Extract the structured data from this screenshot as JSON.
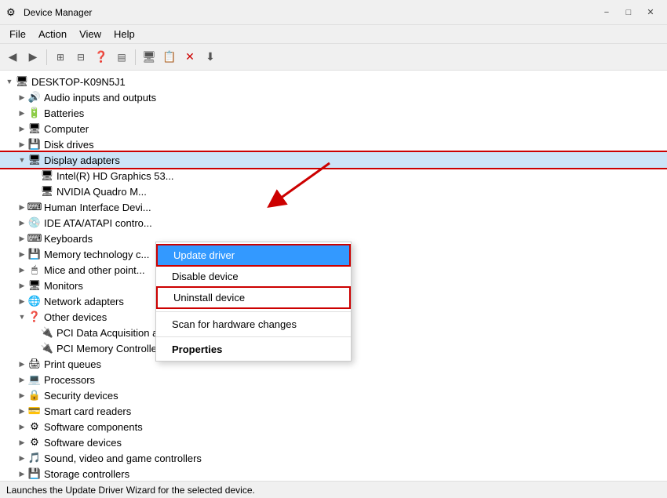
{
  "window": {
    "title": "Device Manager",
    "icon": "⚙"
  },
  "menubar": {
    "items": [
      "File",
      "Action",
      "View",
      "Help"
    ]
  },
  "toolbar": {
    "buttons": [
      "◀",
      "▶",
      "⊞",
      "⊟",
      "❓",
      "☰",
      "🖥",
      "📋",
      "✕",
      "⬇"
    ]
  },
  "tree": {
    "root": {
      "label": "DESKTOP-K09N5J1",
      "expanded": true
    },
    "items": [
      {
        "id": "audio",
        "label": "Audio inputs and outputs",
        "indent": 1,
        "expandable": true,
        "expanded": false,
        "icon": "🔊"
      },
      {
        "id": "batteries",
        "label": "Batteries",
        "indent": 1,
        "expandable": true,
        "expanded": false,
        "icon": "🔋"
      },
      {
        "id": "computer",
        "label": "Computer",
        "indent": 1,
        "expandable": true,
        "expanded": false,
        "icon": "🖥"
      },
      {
        "id": "disk",
        "label": "Disk drives",
        "indent": 1,
        "expandable": true,
        "expanded": false,
        "icon": "💾"
      },
      {
        "id": "display",
        "label": "Display adapters",
        "indent": 1,
        "expandable": true,
        "expanded": true,
        "icon": "🖥",
        "selected": true
      },
      {
        "id": "intel",
        "label": "Intel(R) HD Graphics 53...",
        "indent": 2,
        "expandable": false,
        "icon": "🖥"
      },
      {
        "id": "nvidia",
        "label": "NVIDIA Quadro M...",
        "indent": 2,
        "expandable": false,
        "icon": "🖥"
      },
      {
        "id": "hid",
        "label": "Human Interface Devi...",
        "indent": 1,
        "expandable": true,
        "expanded": false,
        "icon": "⌨"
      },
      {
        "id": "ide",
        "label": "IDE ATA/ATAPI contro...",
        "indent": 1,
        "expandable": true,
        "expanded": false,
        "icon": "💿"
      },
      {
        "id": "keyboards",
        "label": "Keyboards",
        "indent": 1,
        "expandable": true,
        "expanded": false,
        "icon": "⌨"
      },
      {
        "id": "memory",
        "label": "Memory technology c...",
        "indent": 1,
        "expandable": true,
        "expanded": false,
        "icon": "💾"
      },
      {
        "id": "mice",
        "label": "Mice and other point...",
        "indent": 1,
        "expandable": true,
        "expanded": false,
        "icon": "🖱"
      },
      {
        "id": "monitors",
        "label": "Monitors",
        "indent": 1,
        "expandable": true,
        "expanded": false,
        "icon": "🖥"
      },
      {
        "id": "network",
        "label": "Network adapters",
        "indent": 1,
        "expandable": true,
        "expanded": false,
        "icon": "🌐"
      },
      {
        "id": "other",
        "label": "Other devices",
        "indent": 1,
        "expandable": true,
        "expanded": true,
        "icon": "❓"
      },
      {
        "id": "pci-dsp",
        "label": "PCI Data Acquisition and Signal Processing Controller",
        "indent": 2,
        "expandable": false,
        "icon": "🔌"
      },
      {
        "id": "pci-mem",
        "label": "PCI Memory Controller",
        "indent": 2,
        "expandable": false,
        "icon": "🔌"
      },
      {
        "id": "print",
        "label": "Print queues",
        "indent": 1,
        "expandable": true,
        "expanded": false,
        "icon": "🖨"
      },
      {
        "id": "proc",
        "label": "Processors",
        "indent": 1,
        "expandable": true,
        "expanded": false,
        "icon": "💻"
      },
      {
        "id": "security",
        "label": "Security devices",
        "indent": 1,
        "expandable": true,
        "expanded": false,
        "icon": "🔒"
      },
      {
        "id": "smartcard",
        "label": "Smart card readers",
        "indent": 1,
        "expandable": true,
        "expanded": false,
        "icon": "💳"
      },
      {
        "id": "softcomp",
        "label": "Software components",
        "indent": 1,
        "expandable": true,
        "expanded": false,
        "icon": "⚙"
      },
      {
        "id": "softdev",
        "label": "Software devices",
        "indent": 1,
        "expandable": true,
        "expanded": false,
        "icon": "⚙"
      },
      {
        "id": "sound",
        "label": "Sound, video and game controllers",
        "indent": 1,
        "expandable": true,
        "expanded": false,
        "icon": "🎵"
      },
      {
        "id": "storage",
        "label": "Storage controllers",
        "indent": 1,
        "expandable": true,
        "expanded": false,
        "icon": "💾"
      }
    ]
  },
  "contextMenu": {
    "items": [
      {
        "id": "update-driver",
        "label": "Update driver",
        "highlighted": true
      },
      {
        "id": "disable-device",
        "label": "Disable device",
        "highlighted": false
      },
      {
        "id": "uninstall-device",
        "label": "Uninstall device",
        "highlighted": false,
        "bordered": true
      },
      {
        "id": "scan-changes",
        "label": "Scan for hardware changes",
        "highlighted": false
      },
      {
        "id": "properties",
        "label": "Properties",
        "bold": true
      }
    ]
  },
  "statusBar": {
    "text": "Launches the Update Driver Wizard for the selected device."
  },
  "colors": {
    "highlight": "#3399ff",
    "redAccent": "#cc0000",
    "selectedBg": "#cce4f7"
  }
}
